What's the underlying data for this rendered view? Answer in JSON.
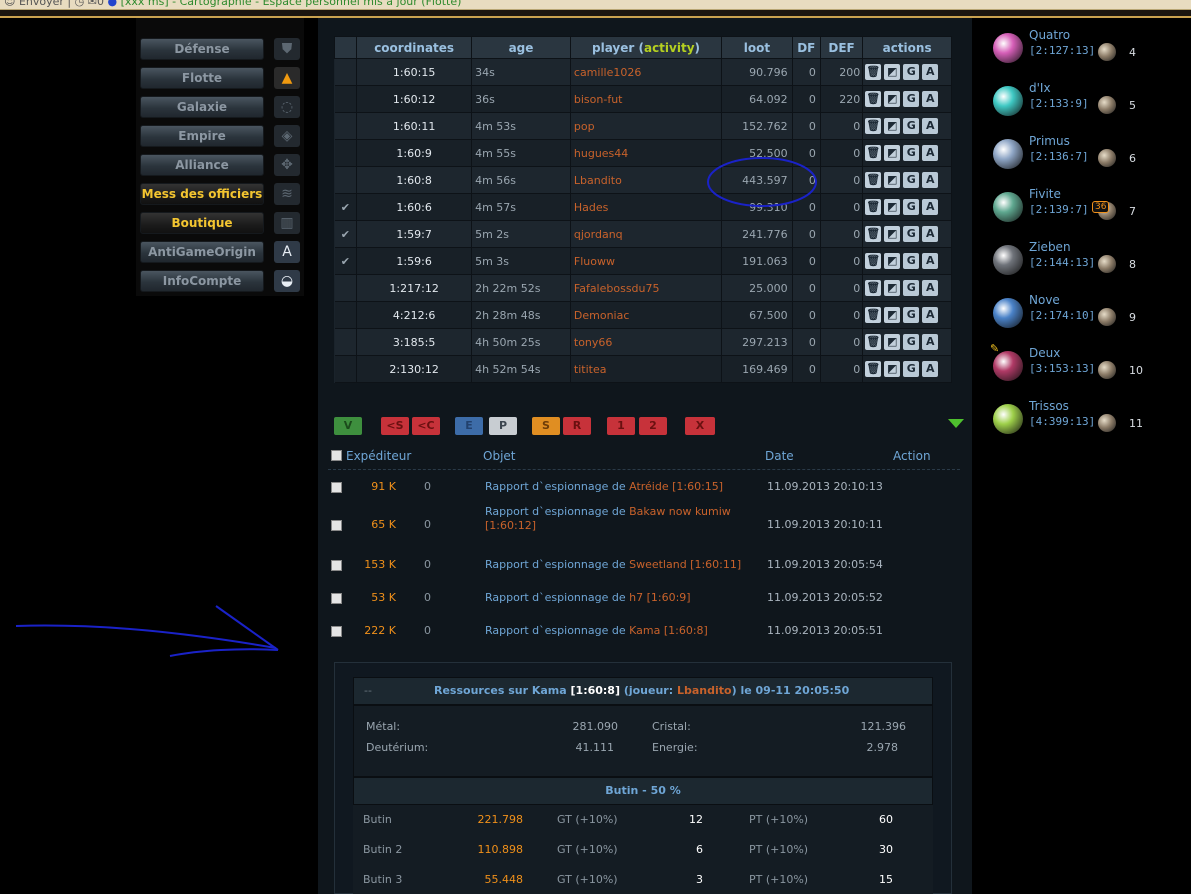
{
  "topbar": {
    "prefix": "☺ Envoyer |",
    "counter": "0",
    "status": "[xxx ms] - Cartographie - Espace personnel mis à jour (Flotte)"
  },
  "menu": [
    {
      "label": "Défense",
      "icon": "defense-icon",
      "glyph": "⛊"
    },
    {
      "label": "Flotte",
      "icon": "fleet-icon",
      "glyph": "▲"
    },
    {
      "label": "Galaxie",
      "icon": "galaxy-icon",
      "glyph": "◌"
    },
    {
      "label": "Empire",
      "icon": "empire-icon",
      "glyph": "◈"
    },
    {
      "label": "Alliance",
      "icon": "alliance-icon",
      "glyph": "✥"
    },
    {
      "label": "Mess des officiers",
      "icon": "officers-icon",
      "glyph": "≋"
    },
    {
      "label": "Boutique",
      "icon": "shop-icon",
      "glyph": "▥"
    },
    {
      "label": "AntiGameOrigin",
      "icon": "antigame-icon",
      "glyph": "A"
    },
    {
      "label": "InfoCompte",
      "icon": "infocompte-icon",
      "glyph": "◒"
    }
  ],
  "galaxy": {
    "headers": {
      "coordinates": "coordinates",
      "age": "age",
      "player": "player",
      "activity": "activity",
      "loot": "loot",
      "df": "DF",
      "def": "DEF",
      "actions": "actions"
    },
    "rows": [
      {
        "check": "",
        "coord": "1:60:15",
        "age": "34s",
        "player": "camille1026",
        "loot": "90.796",
        "df": "0",
        "def": "200"
      },
      {
        "check": "",
        "coord": "1:60:12",
        "age": "36s",
        "player": "bison-fut",
        "loot": "64.092",
        "df": "0",
        "def": "220"
      },
      {
        "check": "",
        "coord": "1:60:11",
        "age": "4m 53s",
        "player": "pop",
        "loot": "152.762",
        "df": "0",
        "def": "0"
      },
      {
        "check": "",
        "coord": "1:60:9",
        "age": "4m 55s",
        "player": "hugues44",
        "loot": "52.500",
        "df": "0",
        "def": "0"
      },
      {
        "check": "",
        "coord": "1:60:8",
        "age": "4m 56s",
        "player": "Lbandito",
        "loot": "443.597",
        "df": "0",
        "def": "0"
      },
      {
        "check": "✔",
        "coord": "1:60:6",
        "age": "4m 57s",
        "player": "Hades",
        "loot": "99.310",
        "df": "0",
        "def": "0"
      },
      {
        "check": "✔",
        "coord": "1:59:7",
        "age": "5m 2s",
        "player": "qjordanq",
        "loot": "241.776",
        "df": "0",
        "def": "0"
      },
      {
        "check": "✔",
        "coord": "1:59:6",
        "age": "5m 3s",
        "player": "Fluoww",
        "loot": "191.063",
        "df": "0",
        "def": "0"
      },
      {
        "check": "",
        "coord": "1:217:12",
        "age": "2h 22m 52s",
        "player": "Fafalebossdu75",
        "loot": "25.000",
        "df": "0",
        "def": "0"
      },
      {
        "check": "",
        "coord": "4:212:6",
        "age": "2h 28m 48s",
        "player": "Demoniac",
        "loot": "67.500",
        "df": "0",
        "def": "0"
      },
      {
        "check": "",
        "coord": "3:185:5",
        "age": "4h 50m 25s",
        "player": "tony66",
        "loot": "297.213",
        "df": "0",
        "def": "0"
      },
      {
        "check": "",
        "coord": "2:130:12",
        "age": "4h 52m 54s",
        "player": "tititea",
        "loot": "169.469",
        "df": "0",
        "def": "0"
      }
    ],
    "action_labels": [
      "🗑",
      "◩",
      "G",
      "A"
    ]
  },
  "filters": {
    "v": "V",
    "s_back": "<S",
    "c_back": "<C",
    "e": "E",
    "p": "P",
    "s": "S",
    "r": "R",
    "one": "1",
    "two": "2",
    "x": "X"
  },
  "messages": {
    "headers": {
      "sender": "Expéditeur",
      "subject": "Objet",
      "date": "Date",
      "action": "Action"
    },
    "rows": [
      {
        "size": "91 K",
        "zero": "0",
        "subject": "Rapport d`espionnage de",
        "target": "Atréide [1:60:15]",
        "date": "11.09.2013 20:10:13"
      },
      {
        "size": "65 K",
        "zero": "0",
        "subject": "Rapport d`espionnage de",
        "target": "Bakaw now kumiw [1:60:12]",
        "date": "11.09.2013 20:10:11"
      },
      {
        "size": "153 K",
        "zero": "0",
        "subject": "Rapport d`espionnage de",
        "target": "Sweetland [1:60:11]",
        "date": "11.09.2013 20:05:54"
      },
      {
        "size": "53 K",
        "zero": "0",
        "subject": "Rapport d`espionnage de",
        "target": "h7 [1:60:9]",
        "date": "11.09.2013 20:05:52"
      },
      {
        "size": "222 K",
        "zero": "0",
        "subject": "Rapport d`espionnage de",
        "target": "Kama [1:60:8]",
        "date": "11.09.2013 20:05:51"
      }
    ]
  },
  "report": {
    "dash": "--",
    "title_pre": "Ressources sur Kama",
    "title_coord": "[1:60:8]",
    "title_joueur": "(joueur:",
    "title_player": "Lbandito",
    "title_post": ") le 09-11 20:05:50",
    "metal_label": "Métal:",
    "metal": "281.090",
    "cristal_label": "Cristal:",
    "cristal": "121.396",
    "deut_label": "Deutérium:",
    "deut": "41.111",
    "energie_label": "Energie:",
    "energie": "2.978",
    "butin_header": "Butin - 50 %",
    "butin_rows": [
      {
        "label": "Butin",
        "value": "221.798",
        "gt": "GT (+10%)",
        "gt_n": "12",
        "pt": "PT (+10%)",
        "pt_n": "60"
      },
      {
        "label": "Butin 2",
        "value": "110.898",
        "gt": "GT (+10%)",
        "gt_n": "6",
        "pt": "PT (+10%)",
        "pt_n": "30"
      },
      {
        "label": "Butin 3",
        "value": "55.448",
        "gt": "GT (+10%)",
        "gt_n": "3",
        "pt": "PT (+10%)",
        "pt_n": "15"
      }
    ]
  },
  "planets": [
    {
      "name": "Quatro",
      "coord": "[2:127:13]",
      "num": "4",
      "color": "#d65fb8"
    },
    {
      "name": "d'Ix",
      "coord": "[2:133:9]",
      "num": "5",
      "color": "#3fc9c4"
    },
    {
      "name": "Primus",
      "coord": "[2:136:7]",
      "num": "6",
      "color": "#8fa6c6"
    },
    {
      "name": "Fivite",
      "coord": "[2:139:7]",
      "num": "7",
      "color": "#5fa890",
      "badge": "36"
    },
    {
      "name": "Zieben",
      "coord": "[2:144:13]",
      "num": "8",
      "color": "#6f737a"
    },
    {
      "name": "Nove",
      "coord": "[2:174:10]",
      "num": "9",
      "color": "#4a82c8"
    },
    {
      "name": "Deux",
      "coord": "[3:153:13]",
      "num": "10",
      "color": "#b03a66"
    },
    {
      "name": "Trissos",
      "coord": "[4:399:13]",
      "num": "11",
      "color": "#9ed04a"
    }
  ],
  "colors": {
    "accent_blue": "#6fa6d6",
    "player_orange": "#c8622b",
    "loot_orange": "#f0901a",
    "check_green": "#8ad31a"
  }
}
